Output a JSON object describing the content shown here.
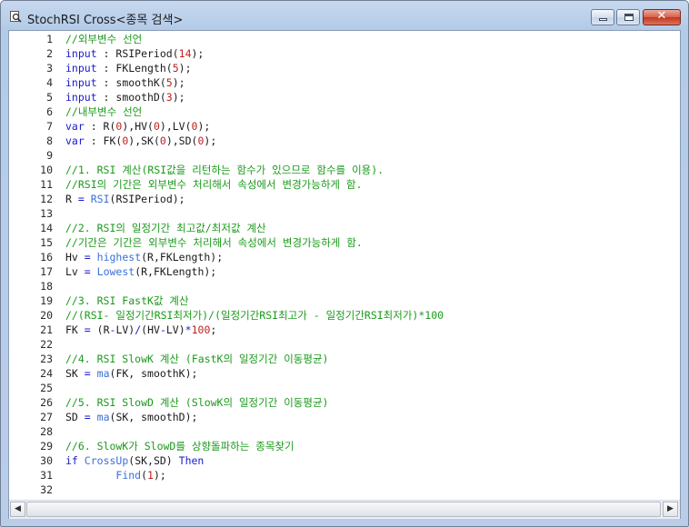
{
  "window": {
    "title": "StochRSI Cross<종목 검색>",
    "icon": "search-document-icon",
    "buttons": {
      "minimize": "minimize-icon",
      "maximize": "maximize-icon",
      "close_label": "✕"
    }
  },
  "colors": {
    "comment": "#1a9a1a",
    "keyword": "#1a1ad0",
    "function": "#3a6fd8",
    "number": "#c02020"
  },
  "code": [
    {
      "n": "1",
      "t": [
        [
          "cmt",
          "//외부변수 선언"
        ]
      ]
    },
    {
      "n": "2",
      "t": [
        [
          "kw",
          "input"
        ],
        [
          "plain",
          " : RSIPeriod("
        ],
        [
          "num",
          "14"
        ],
        [
          "plain",
          ");"
        ]
      ]
    },
    {
      "n": "3",
      "t": [
        [
          "kw",
          "input"
        ],
        [
          "plain",
          " : FKLength("
        ],
        [
          "num",
          "5"
        ],
        [
          "plain",
          ");"
        ]
      ]
    },
    {
      "n": "4",
      "t": [
        [
          "kw",
          "input"
        ],
        [
          "plain",
          " : smoothK("
        ],
        [
          "num",
          "5"
        ],
        [
          "plain",
          ");"
        ]
      ]
    },
    {
      "n": "5",
      "t": [
        [
          "kw",
          "input"
        ],
        [
          "plain",
          " : smoothD("
        ],
        [
          "num",
          "3"
        ],
        [
          "plain",
          ");"
        ]
      ]
    },
    {
      "n": "6",
      "t": [
        [
          "cmt",
          "//내부변수 선언"
        ]
      ]
    },
    {
      "n": "7",
      "t": [
        [
          "kw",
          "var"
        ],
        [
          "plain",
          " : R("
        ],
        [
          "num",
          "0"
        ],
        [
          "plain",
          "),HV("
        ],
        [
          "num",
          "0"
        ],
        [
          "plain",
          "),LV("
        ],
        [
          "num",
          "0"
        ],
        [
          "plain",
          ");"
        ]
      ]
    },
    {
      "n": "8",
      "t": [
        [
          "kw",
          "var"
        ],
        [
          "plain",
          " : FK("
        ],
        [
          "num",
          "0"
        ],
        [
          "plain",
          "),SK("
        ],
        [
          "num",
          "0"
        ],
        [
          "plain",
          "),SD("
        ],
        [
          "num",
          "0"
        ],
        [
          "plain",
          ");"
        ]
      ]
    },
    {
      "n": "9",
      "t": []
    },
    {
      "n": "10",
      "t": [
        [
          "cmt",
          "//1. RSI 계산(RSI값을 리턴하는 함수가 있으므로 함수를 이용)."
        ]
      ]
    },
    {
      "n": "11",
      "t": [
        [
          "cmt",
          "//RSI의 기간은 외부변수 처리해서 속성에서 변경가능하게 함."
        ]
      ]
    },
    {
      "n": "12",
      "t": [
        [
          "plain",
          "R "
        ],
        [
          "op",
          "="
        ],
        [
          "plain",
          " "
        ],
        [
          "fn",
          "RSI"
        ],
        [
          "plain",
          "(RSIPeriod);"
        ]
      ]
    },
    {
      "n": "13",
      "t": []
    },
    {
      "n": "14",
      "t": [
        [
          "cmt",
          "//2. RSI의 일정기간 최고값/최저값 계산"
        ]
      ]
    },
    {
      "n": "15",
      "t": [
        [
          "cmt",
          "//기간은 기간은 외부변수 처리해서 속성에서 변경가능하게 함."
        ]
      ]
    },
    {
      "n": "16",
      "t": [
        [
          "plain",
          "Hv "
        ],
        [
          "op",
          "="
        ],
        [
          "plain",
          " "
        ],
        [
          "fn",
          "highest"
        ],
        [
          "plain",
          "(R,FKLength);"
        ]
      ]
    },
    {
      "n": "17",
      "t": [
        [
          "plain",
          "Lv "
        ],
        [
          "op",
          "="
        ],
        [
          "plain",
          " "
        ],
        [
          "fn",
          "Lowest"
        ],
        [
          "plain",
          "(R,FKLength);"
        ]
      ]
    },
    {
      "n": "18",
      "t": []
    },
    {
      "n": "19",
      "t": [
        [
          "cmt",
          "//3. RSI FastK값 계산"
        ]
      ]
    },
    {
      "n": "20",
      "t": [
        [
          "cmt",
          "//(RSI- 일정기간RSI최저가)/(일정기간RSI최고가 - 일정기간RSI최저가)*100"
        ]
      ]
    },
    {
      "n": "21",
      "t": [
        [
          "plain",
          "FK "
        ],
        [
          "op",
          "="
        ],
        [
          "plain",
          " (R"
        ],
        [
          "op",
          "-"
        ],
        [
          "plain",
          "LV)"
        ],
        [
          "op",
          "/"
        ],
        [
          "plain",
          "(HV"
        ],
        [
          "op",
          "-"
        ],
        [
          "plain",
          "LV)"
        ],
        [
          "op",
          "*"
        ],
        [
          "num",
          "100"
        ],
        [
          "plain",
          ";"
        ]
      ]
    },
    {
      "n": "22",
      "t": []
    },
    {
      "n": "23",
      "t": [
        [
          "cmt",
          "//4. RSI SlowK 계산 (FastK의 일정기간 이동평균)"
        ]
      ]
    },
    {
      "n": "24",
      "t": [
        [
          "plain",
          "SK "
        ],
        [
          "op",
          "="
        ],
        [
          "plain",
          " "
        ],
        [
          "fn",
          "ma"
        ],
        [
          "plain",
          "(FK, smoothK);"
        ]
      ]
    },
    {
      "n": "25",
      "t": []
    },
    {
      "n": "26",
      "t": [
        [
          "cmt",
          "//5. RSI SlowD 계산 (SlowK의 일정기간 이동평균)"
        ]
      ]
    },
    {
      "n": "27",
      "t": [
        [
          "plain",
          "SD "
        ],
        [
          "op",
          "="
        ],
        [
          "plain",
          " "
        ],
        [
          "fn",
          "ma"
        ],
        [
          "plain",
          "(SK, smoothD);"
        ]
      ]
    },
    {
      "n": "28",
      "t": []
    },
    {
      "n": "29",
      "t": [
        [
          "cmt",
          "//6. SlowK가 SlowD를 상향돌파하는 종목찾기"
        ]
      ]
    },
    {
      "n": "30",
      "t": [
        [
          "kw",
          "if"
        ],
        [
          "plain",
          " "
        ],
        [
          "fn",
          "CrossUp"
        ],
        [
          "plain",
          "(SK,SD) "
        ],
        [
          "kw",
          "Then"
        ]
      ]
    },
    {
      "n": "31",
      "t": [
        [
          "plain",
          "        "
        ],
        [
          "fn",
          "Find"
        ],
        [
          "plain",
          "("
        ],
        [
          "num",
          "1"
        ],
        [
          "plain",
          ");"
        ]
      ]
    },
    {
      "n": "32",
      "t": []
    }
  ],
  "scrollbar": {
    "left_arrow": "◀",
    "right_arrow": "▶"
  }
}
